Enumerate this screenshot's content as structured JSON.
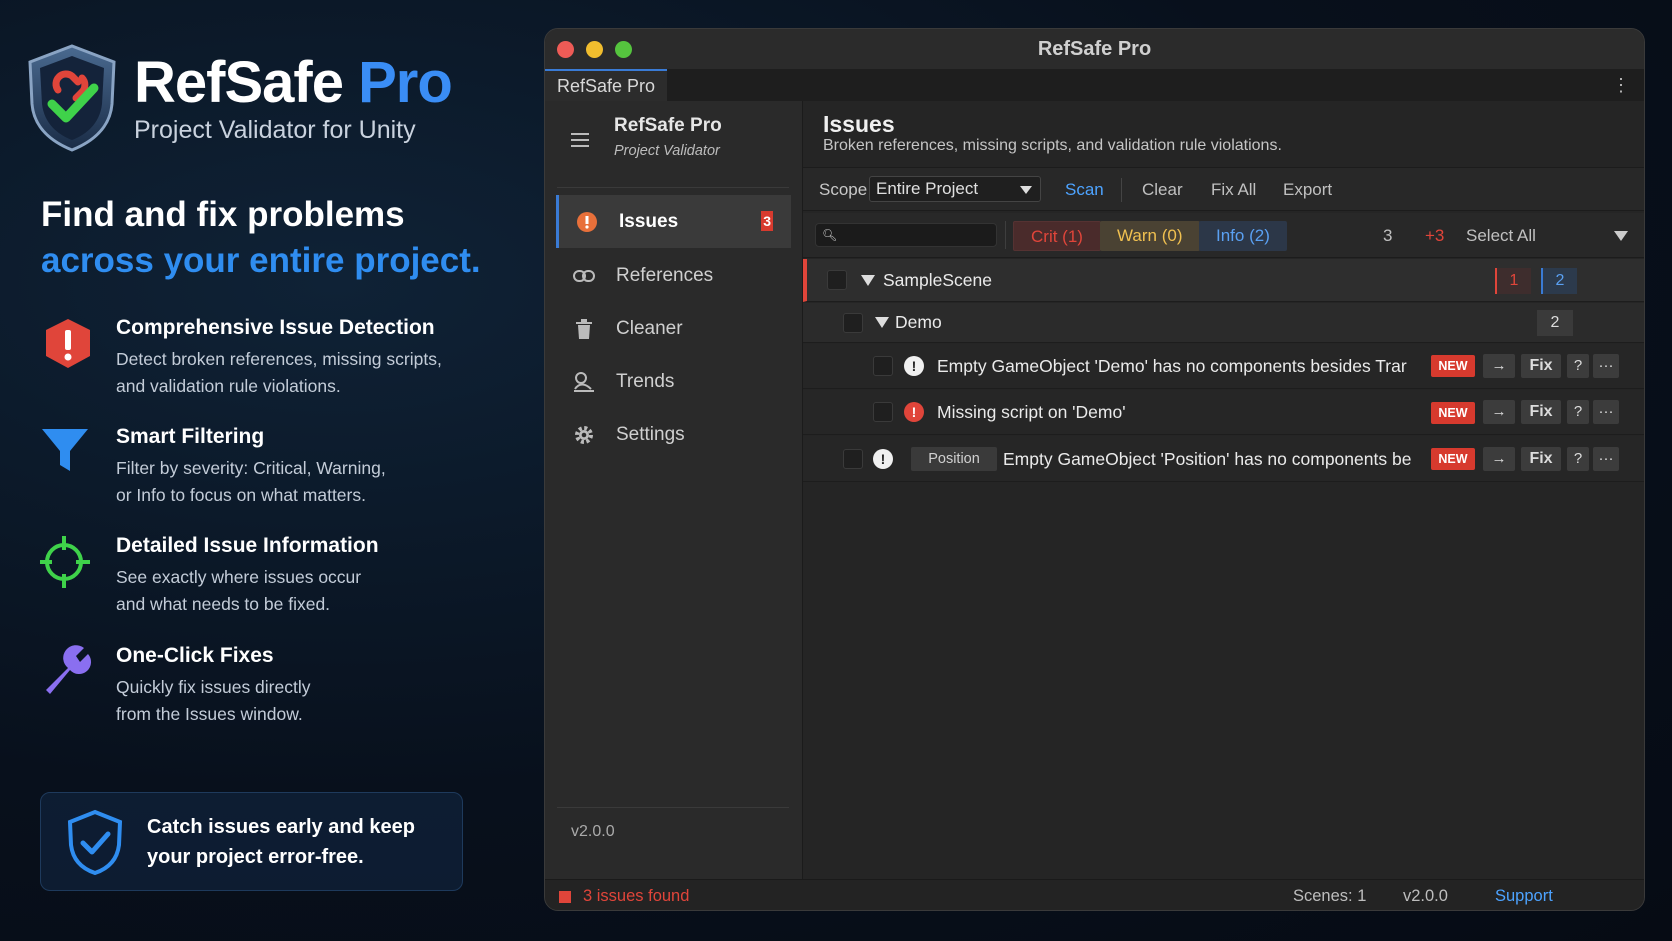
{
  "promo": {
    "brand_name": "RefSafe",
    "brand_pro": "Pro",
    "brand_subtitle": "Project Validator for Unity",
    "headline_line1": "Find and fix problems",
    "headline_line2": "across your entire project.",
    "features": [
      {
        "title": "Comprehensive Issue Detection",
        "desc": "Detect broken references, missing scripts,\nand validation rule violations.",
        "icon": "alert-octagon-icon"
      },
      {
        "title": "Smart Filtering",
        "desc": "Filter by severity: Critical, Warning,\nor Info to focus on what matters.",
        "icon": "funnel-icon"
      },
      {
        "title": "Detailed Issue Information",
        "desc": "See exactly where issues occur\nand what needs to be fixed.",
        "icon": "crosshair-icon"
      },
      {
        "title": "One-Click Fixes",
        "desc": "Quickly fix issues directly\nfrom the Issues window.",
        "icon": "wrench-icon"
      }
    ],
    "callout": "Catch issues early and keep\nyour project error-free."
  },
  "window": {
    "title": "RefSafe Pro",
    "tab": "RefSafe Pro"
  },
  "sidebar": {
    "title": "RefSafe Pro",
    "subtitle": "Project Validator",
    "items": [
      {
        "label": "Issues",
        "icon": "alert-circle-icon",
        "badge": "3"
      },
      {
        "label": "References",
        "icon": "link-icon"
      },
      {
        "label": "Cleaner",
        "icon": "trash-icon"
      },
      {
        "label": "Trends",
        "icon": "chart-icon"
      },
      {
        "label": "Settings",
        "icon": "gear-icon"
      }
    ],
    "version": "v2.0.0"
  },
  "main": {
    "title": "Issues",
    "subtitle": "Broken references, missing scripts, and validation rule violations.",
    "toolbar": {
      "scope_label": "Scope",
      "scope_value": "Entire Project",
      "scan": "Scan",
      "clear": "Clear",
      "fix_all": "Fix All",
      "export": "Export"
    },
    "filters": {
      "search_placeholder": "",
      "crit": "Crit (1)",
      "warn": "Warn (0)",
      "info": "Info (2)",
      "count": "3",
      "new_count": "+3",
      "select_all": "Select All"
    },
    "tree": {
      "scene": {
        "name": "SampleScene",
        "crit_count": "1",
        "info_count": "2"
      },
      "group": {
        "name": "Demo",
        "count": "2"
      },
      "issues": [
        {
          "text": "Empty GameObject 'Demo' has no components besides Trar",
          "severity": "info",
          "tag": "",
          "new": "NEW",
          "fix": "Fix",
          "help": "?",
          "more": "···",
          "goto": "→"
        },
        {
          "text": "Missing script on 'Demo'",
          "severity": "error",
          "tag": "",
          "new": "NEW",
          "fix": "Fix",
          "help": "?",
          "more": "···",
          "goto": "→"
        },
        {
          "text": "Empty GameObject 'Position' has no components be",
          "severity": "info",
          "tag": "Position",
          "new": "NEW",
          "fix": "Fix",
          "help": "?",
          "more": "···",
          "goto": "→"
        }
      ]
    }
  },
  "status": {
    "issues_found": "3 issues found",
    "scenes": "Scenes: 1",
    "version": "v2.0.0",
    "support": "Support"
  },
  "colors": {
    "accent": "#3a8df5",
    "critical": "#e0453a",
    "warning": "#f0c050",
    "info": "#5aa0f2"
  }
}
